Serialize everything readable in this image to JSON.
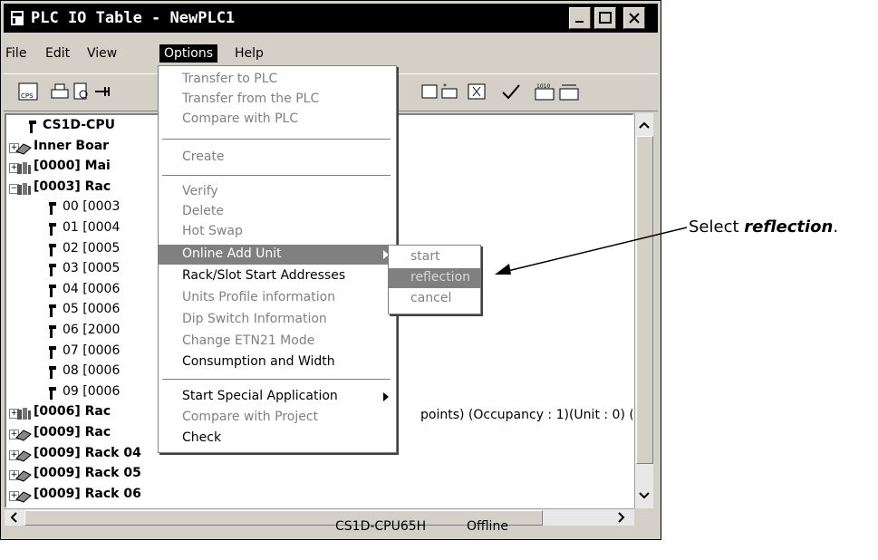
{
  "window": {
    "title": "PLC IO Table - NewPLC1"
  },
  "menubar": {
    "file": "File",
    "edit": "Edit",
    "view": "View",
    "options": "Options",
    "help": "Help"
  },
  "tree": {
    "rows": [
      {
        "text": "CS1D-CPU",
        "bold": true
      },
      {
        "text": "Inner Boar",
        "bold": true
      },
      {
        "text": "[0000] Mai",
        "bold": true
      },
      {
        "text": "[0003] Rac",
        "bold": true
      },
      {
        "text": "00 [0003",
        "bold": false
      },
      {
        "text": "01 [0004",
        "bold": false
      },
      {
        "text": "02 [0005",
        "bold": false
      },
      {
        "text": "03 [0005",
        "bold": false
      },
      {
        "text": "04 [0006",
        "bold": false
      },
      {
        "text": "05 [0006",
        "bold": false
      },
      {
        "text": "06 [2000",
        "bold": false
      },
      {
        "text": "07 [0006",
        "bold": false
      },
      {
        "text": "08 [0006",
        "bold": false
      },
      {
        "text": "09 [0006",
        "bold": false
      },
      {
        "text": "[0006] Rac",
        "bold": true
      },
      {
        "text": "[0009] Rac",
        "bold": true
      },
      {
        "text": "[0009] Rack 04",
        "bold": true
      },
      {
        "text": "[0009] Rack 05",
        "bold": true
      },
      {
        "text": "[0009] Rack 06",
        "bold": true
      }
    ],
    "row06_extra": "points) (Occupancy : 1)(Unit : 0) ("
  },
  "options_menu": {
    "items": [
      "Transfer to PLC",
      "Transfer from the PLC",
      "Compare with PLC",
      "Create",
      "Verify",
      "Delete",
      "Hot Swap",
      "Online Add Unit",
      "Rack/Slot Start Addresses",
      "Units Profile information",
      "Dip Switch Information",
      "Change ETN21 Mode",
      "Consumption and Width",
      "Start Special Application",
      "Compare with Project",
      "Check"
    ]
  },
  "submenu": {
    "items": [
      "start",
      "reflection",
      "cancel"
    ]
  },
  "statusbar": {
    "cpu": "CS1D-CPU65H",
    "state": "Offline"
  },
  "callout": {
    "prefix": "Select ",
    "target": "reflection",
    "suffix": "."
  }
}
